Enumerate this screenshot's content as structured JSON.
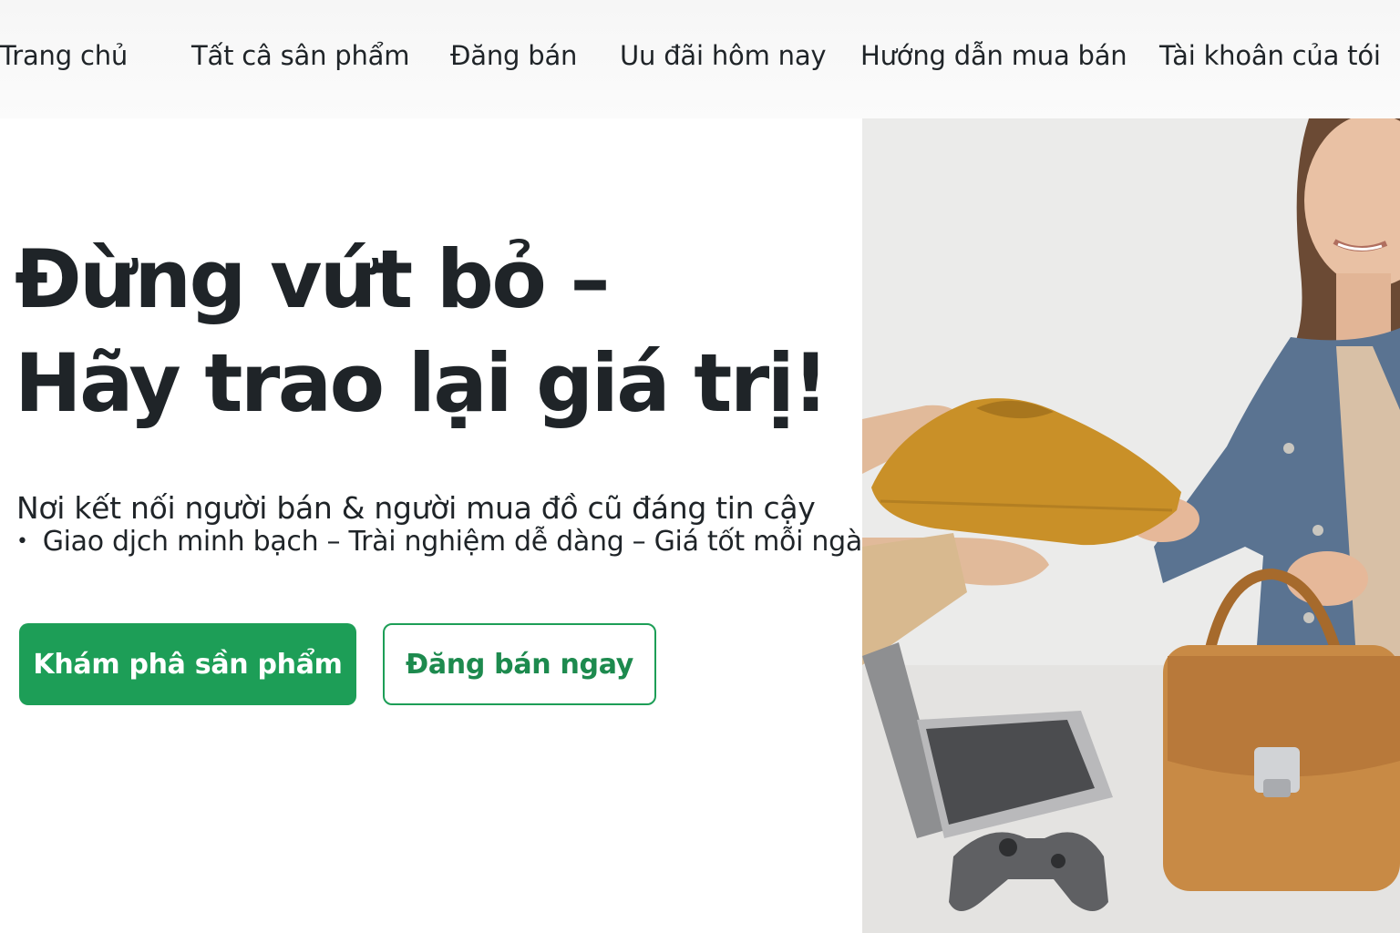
{
  "nav": {
    "items": [
      {
        "label": "Trang chủ"
      },
      {
        "label": "Tất câ sân phẩm"
      },
      {
        "label": "Đăng bán"
      },
      {
        "label": "Uu đãi hôm nay"
      },
      {
        "label": "Hướng dẫn mua bán"
      },
      {
        "label": "Tài khoân của tói"
      }
    ]
  },
  "hero": {
    "title_line1": "Đừng vứt bỏ –",
    "title_line2": "Hãy trao lại giá trị!",
    "subtitle": "Nơi kết nối người bán & người mua đồ cũ đáng tin cậy",
    "features": "Giao djch minh bạch – Trài nghiệm dễ dàng – Giá tốt mỗi ngày",
    "primary_cta": "Khám phâ sần phẩm",
    "secondary_cta": "Đăng bán ngay"
  },
  "colors": {
    "accent": "#1d9e57",
    "text": "#1f2428",
    "background": "#ffffff"
  },
  "photo": {
    "subject": "hero-photo-woman-receiving-folded-tshirt-with-handbag-laptop-gamepad"
  }
}
